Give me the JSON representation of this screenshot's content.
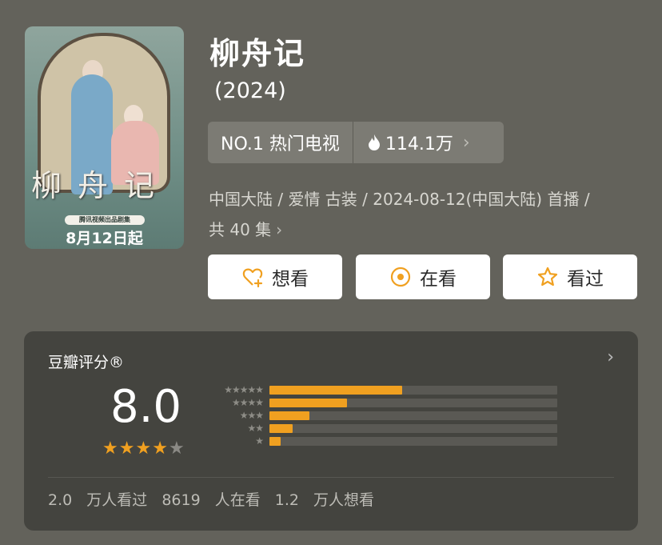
{
  "poster": {
    "callig_text": "柳舟记",
    "banner_text": "腾讯视频出品剧集",
    "date_text": "8月12日起"
  },
  "title": "柳舟记",
  "year": "(2024)",
  "rank": {
    "label": "NO.1 热门电视",
    "heat": "114.1万"
  },
  "meta": {
    "line1": "中国大陆 / 爱情 古装 / 2024-08-12(中国大陆) 首播 /",
    "line2": "共 40 集"
  },
  "actions": {
    "want": "想看",
    "watching": "在看",
    "watched": "看过"
  },
  "rating": {
    "header": "豆瓣评分®",
    "score": "8.0",
    "stars_filled": 4,
    "stars_total": 5,
    "distribution": [
      {
        "stars": 5,
        "fraction": 0.46
      },
      {
        "stars": 4,
        "fraction": 0.27
      },
      {
        "stars": 3,
        "fraction": 0.14
      },
      {
        "stars": 2,
        "fraction": 0.08
      },
      {
        "stars": 1,
        "fraction": 0.04
      }
    ],
    "footer": {
      "watched": "2.0 万人看过",
      "watching": "8619 人在看",
      "want": "1.2 万人想看"
    }
  },
  "colors": {
    "accent": "#f0a020",
    "background": "#63625b",
    "card": "#44443f"
  }
}
